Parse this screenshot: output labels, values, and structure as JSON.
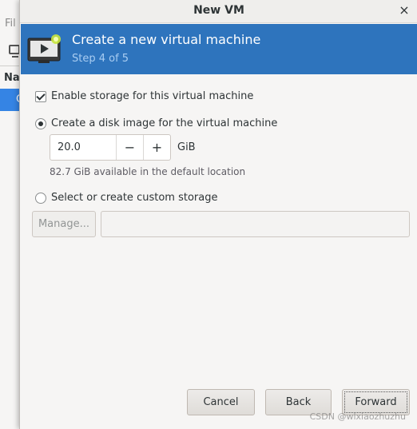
{
  "background": {
    "menu_file": "Fil",
    "column_name": "Na",
    "selected_row": "C"
  },
  "dialog": {
    "title": "New VM",
    "close_glyph": "×"
  },
  "header": {
    "title": "Create a new virtual machine",
    "step": "Step 4 of 5",
    "icon": "monitor-play-icon",
    "color": "#2e74bd"
  },
  "storage": {
    "enable_label": "Enable storage for this virtual machine",
    "enable_checked": true,
    "disk_image_label": "Create a disk image for the virtual machine",
    "disk_image_selected": true,
    "size_value": "20.0",
    "decrement": "−",
    "increment": "+",
    "unit": "GiB",
    "available_text": "82.7 GiB available in the default location",
    "custom_label": "Select or create custom storage",
    "custom_selected": false,
    "manage_label": "Manage...",
    "custom_path": ""
  },
  "buttons": {
    "cancel": "Cancel",
    "back": "Back",
    "forward": "Forward"
  },
  "watermark": "CSDN @wlxiaozhuzhu"
}
